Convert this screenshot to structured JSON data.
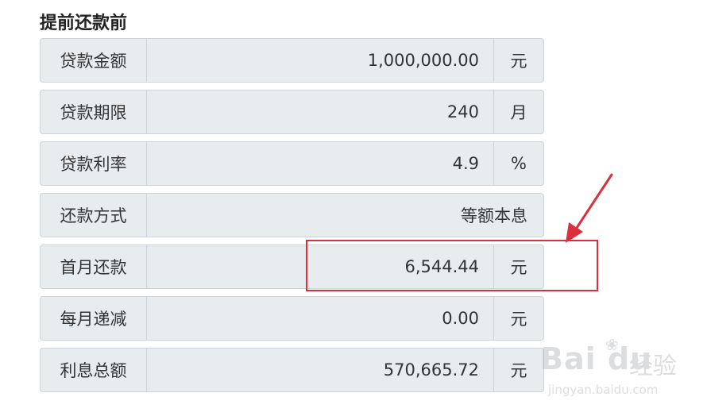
{
  "section_title": "提前还款前",
  "rows": [
    {
      "label": "贷款金额",
      "value": "1,000,000.00",
      "unit": "元"
    },
    {
      "label": "贷款期限",
      "value": "240",
      "unit": "月"
    },
    {
      "label": "贷款利率",
      "value": "4.9",
      "unit": "%"
    },
    {
      "label": "还款方式",
      "value": "等额本息",
      "unit": ""
    },
    {
      "label": "首月还款",
      "value": "6,544.44",
      "unit": "元"
    },
    {
      "label": "每月递减",
      "value": "0.00",
      "unit": "元"
    },
    {
      "label": "利息总额",
      "value": "570,665.72",
      "unit": "元"
    }
  ],
  "annotation": {
    "color": "#d9303b"
  },
  "watermark": {
    "brand": "Bai du",
    "cn": "经验",
    "url": "jingyan.baidu.com"
  }
}
